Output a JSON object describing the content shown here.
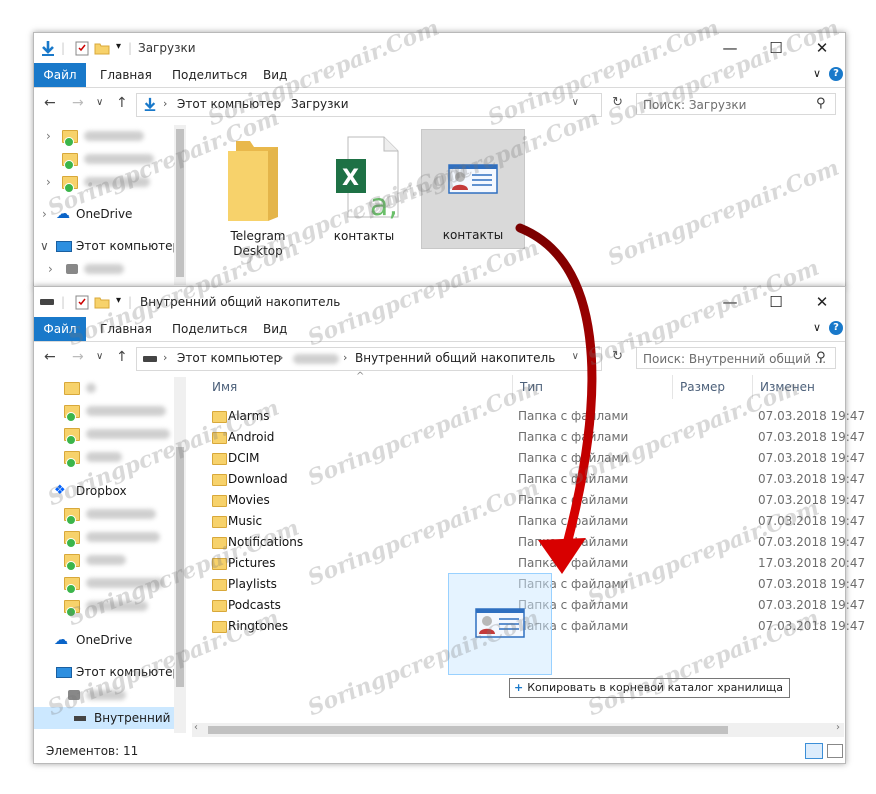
{
  "top_window": {
    "title": "Загрузки",
    "ribbon_tabs": [
      "Файл",
      "Главная",
      "Поделиться",
      "Вид"
    ],
    "address": [
      "Этот компьютер",
      "Загрузки"
    ],
    "search_placeholder": "Поиск: Загрузки",
    "nav": {
      "onedrive": "OneDrive",
      "this_pc": "Этот компьютер"
    },
    "items": [
      {
        "label": "Telegram Desktop",
        "icon": "folder-icon"
      },
      {
        "label": "контакты",
        "icon": "excel-file-icon"
      },
      {
        "label": "контакты",
        "icon": "contact-card-icon"
      }
    ]
  },
  "bottom_window": {
    "title": "Внутренний общий накопитель",
    "ribbon_tabs": [
      "Файл",
      "Главная",
      "Поделиться",
      "Вид"
    ],
    "address": [
      "Этот компьютер",
      "Внутренний общий накопитель"
    ],
    "search_placeholder": "Поиск: Внутренний общий ...",
    "columns": {
      "name": "Имя",
      "type": "Тип",
      "size": "Размер",
      "modified": "Изменен"
    },
    "files": [
      {
        "name": "Alarms",
        "type": "Папка с файлами",
        "date": "07.03.2018 19:47"
      },
      {
        "name": "Android",
        "type": "Папка с файлами",
        "date": "07.03.2018 19:47"
      },
      {
        "name": "DCIM",
        "type": "Папка с файлами",
        "date": "07.03.2018 19:47"
      },
      {
        "name": "Download",
        "type": "Папка с файлами",
        "date": "07.03.2018 19:47"
      },
      {
        "name": "Movies",
        "type": "Папка с файлами",
        "date": "07.03.2018 19:47"
      },
      {
        "name": "Music",
        "type": "Папка с файлами",
        "date": "07.03.2018 19:47"
      },
      {
        "name": "Notifications",
        "type": "Папка с файлами",
        "date": "07.03.2018 19:47"
      },
      {
        "name": "Pictures",
        "type": "Папка с файлами",
        "date": "17.03.2018 20:47"
      },
      {
        "name": "Playlists",
        "type": "Папка с файлами",
        "date": "07.03.2018 19:47"
      },
      {
        "name": "Podcasts",
        "type": "Папка с файлами",
        "date": "07.03.2018 19:47"
      },
      {
        "name": "Ringtones",
        "type": "Папка с файлами",
        "date": "07.03.2018 19:47"
      }
    ],
    "nav": {
      "dropbox": "Dropbox",
      "onedrive": "OneDrive",
      "this_pc": "Этот компьютер",
      "storage": "Внутренний общ"
    },
    "status": "Элементов: 11",
    "drag_tooltip": "Копировать в корневой каталог хранилища",
    "drag_tooltip_plus": "+"
  },
  "watermark": "Soringpcrepair.Com",
  "colors": {
    "accent": "#1979ca",
    "arrow": "#b0000f",
    "folder": "#f7d26b"
  }
}
